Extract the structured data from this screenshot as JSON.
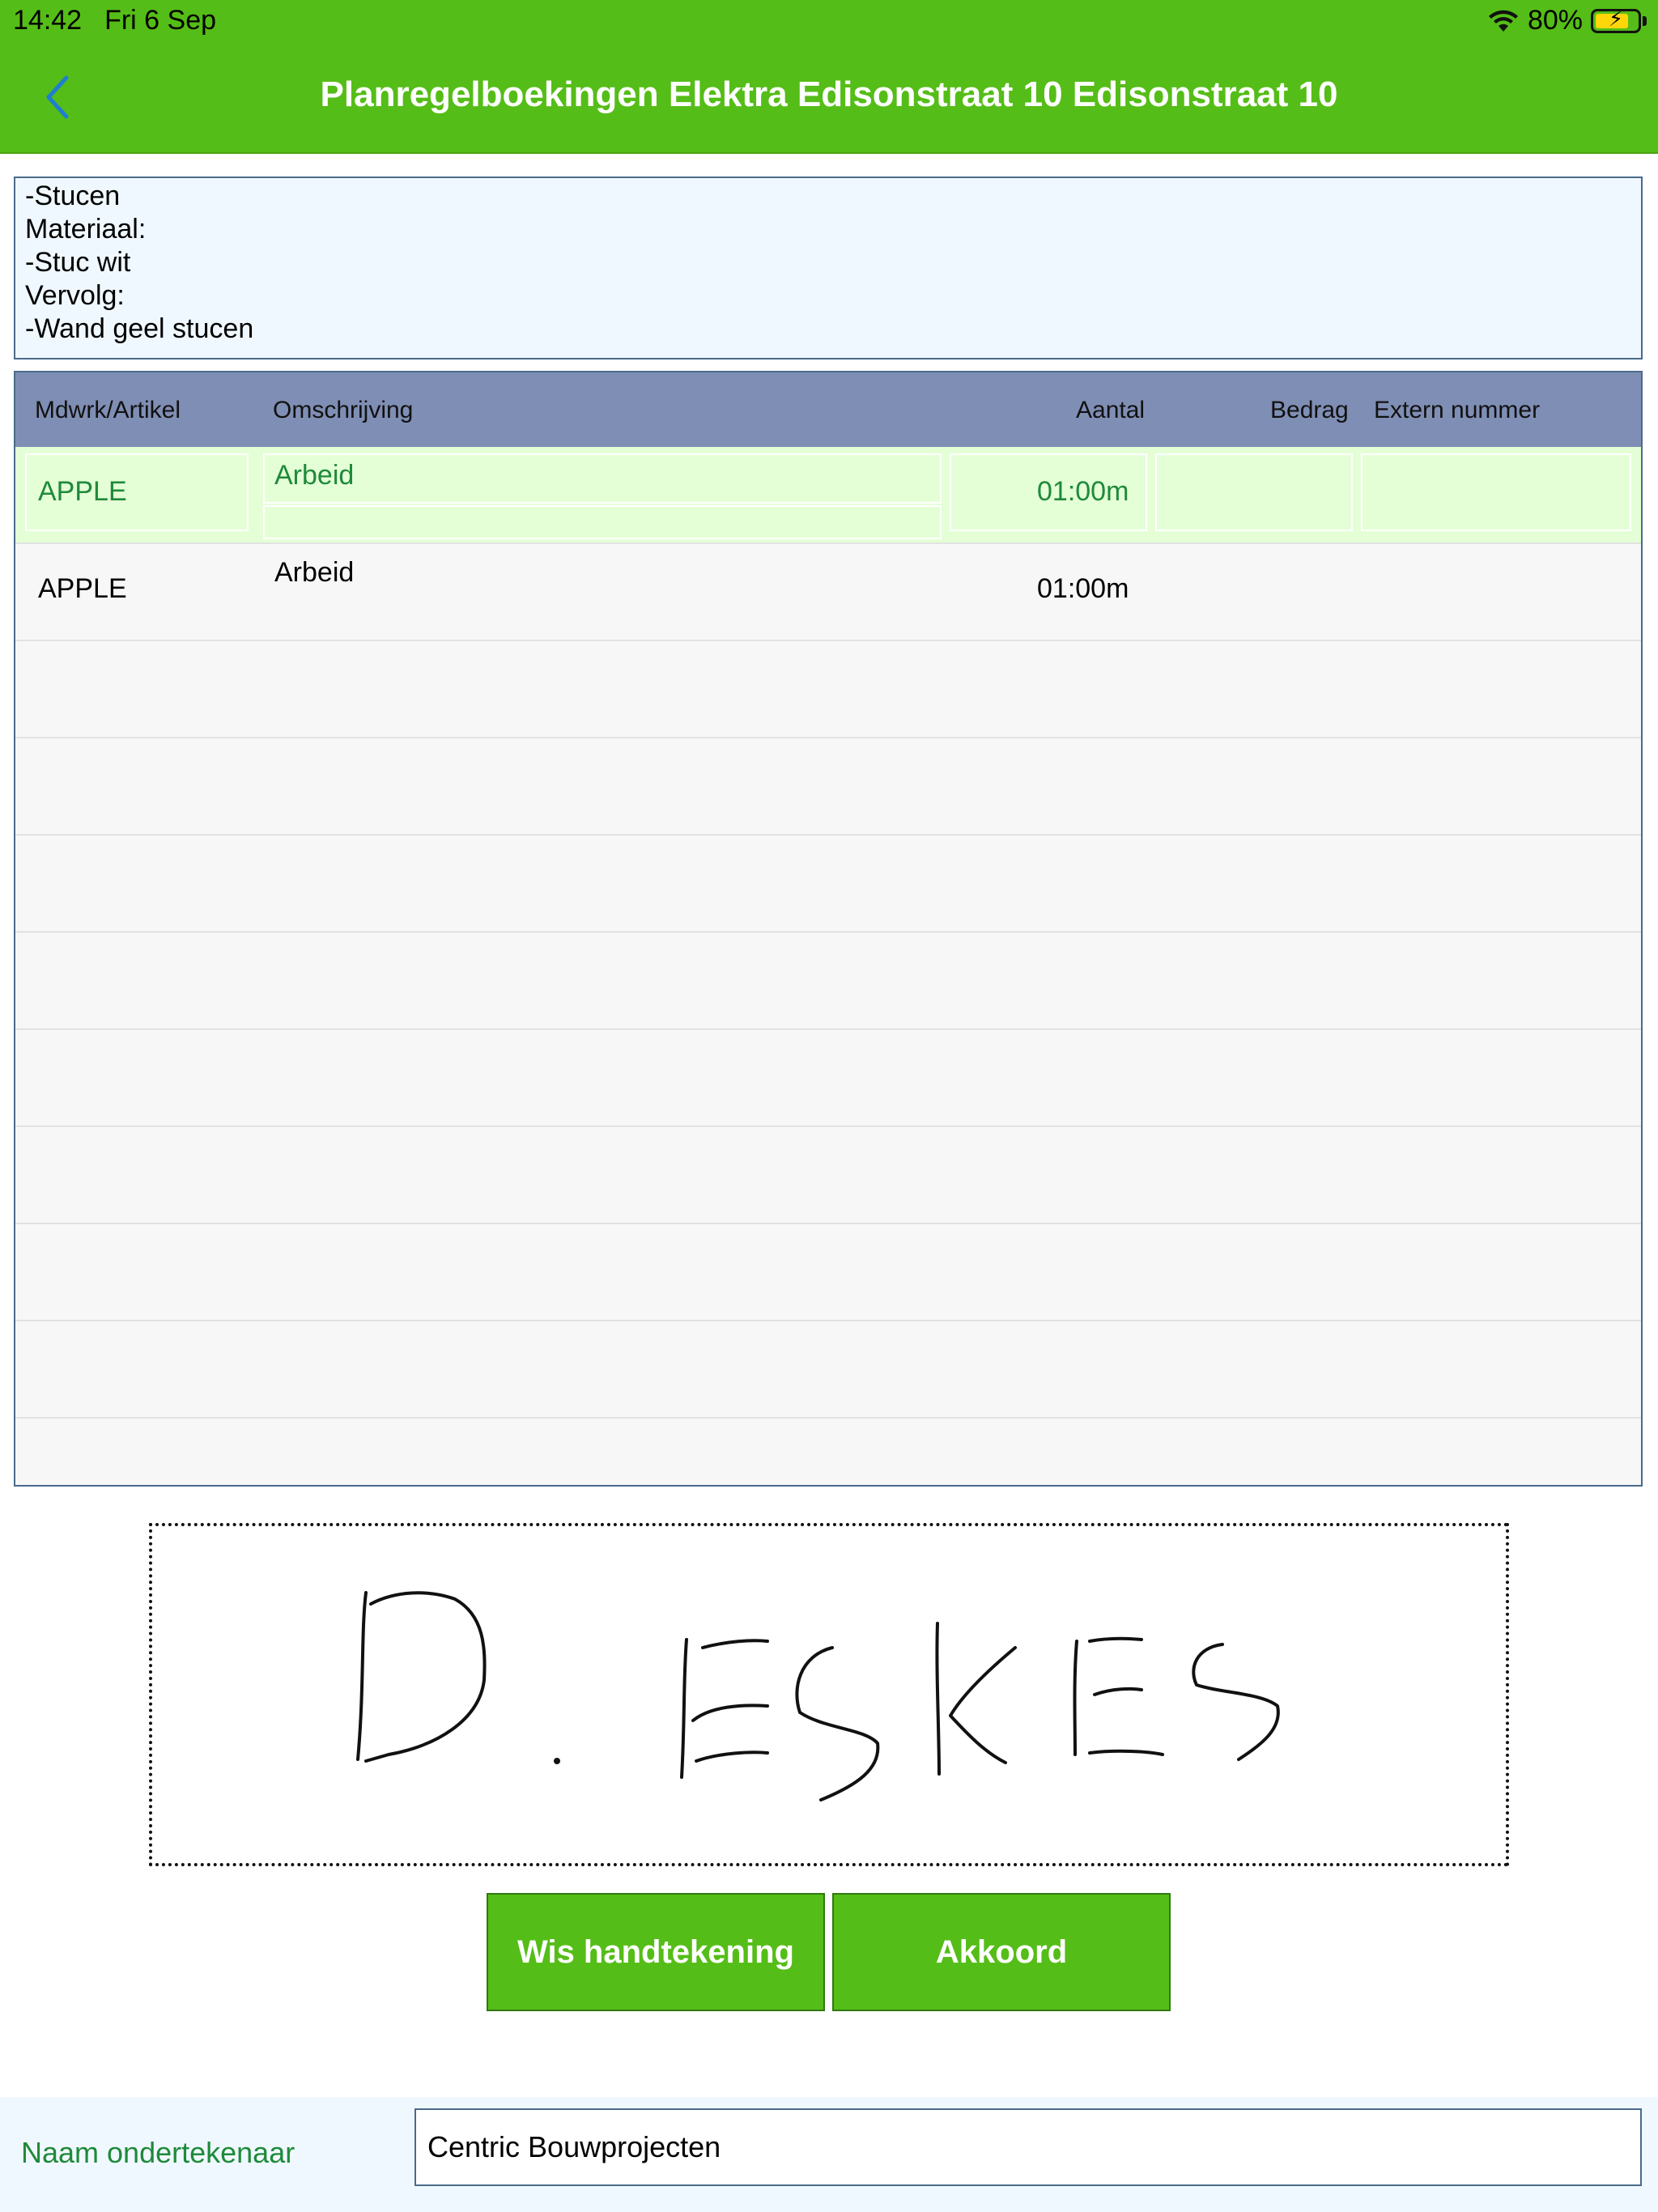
{
  "status_bar": {
    "time": "14:42",
    "date": "Fri 6 Sep",
    "battery": "80%",
    "battery_level": 0.8
  },
  "header": {
    "title": "Planregelboekingen Elektra Edisonstraat 10 Edisonstraat 10",
    "back_icon": "chevron-left-icon",
    "background_color": "#55bd17"
  },
  "notes": {
    "lines": [
      "-Stucen",
      "Materiaal:",
      "-Stuc wit",
      "Vervolg:",
      "-Wand geel stucen"
    ]
  },
  "table": {
    "columns": [
      "Mdwrk/Artikel",
      "Omschrijving",
      "Aantal",
      "Bedrag",
      "Extern nummer"
    ],
    "rows": [
      {
        "artikel": "APPLE",
        "omschrijving": "Arbeid",
        "aantal": "01:00m",
        "bedrag": "",
        "extern": "",
        "selected": true
      },
      {
        "artikel": "APPLE",
        "omschrijving": "Arbeid",
        "aantal": "01:00m",
        "bedrag": "",
        "extern": "",
        "selected": false
      }
    ]
  },
  "signature": {
    "pad_name": "signature-pad"
  },
  "buttons": {
    "clear_label": "Wis handtekening",
    "accept_label": "Akkoord"
  },
  "signer": {
    "label": "Naam ondertekenaar",
    "value": "Centric Bouwprojecten"
  }
}
